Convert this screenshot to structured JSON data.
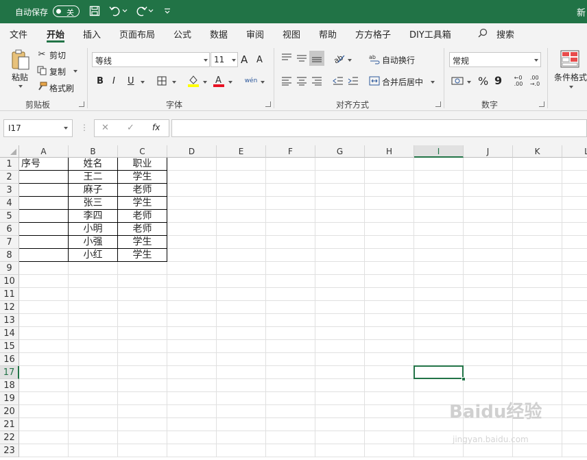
{
  "titlebar": {
    "autosave_label": "自动保存",
    "autosave_state": "关",
    "title": "新"
  },
  "tabs": [
    {
      "label": "文件"
    },
    {
      "label": "开始",
      "active": true
    },
    {
      "label": "插入"
    },
    {
      "label": "页面布局"
    },
    {
      "label": "公式"
    },
    {
      "label": "数据"
    },
    {
      "label": "审阅"
    },
    {
      "label": "视图"
    },
    {
      "label": "帮助"
    },
    {
      "label": "方方格子"
    },
    {
      "label": "DIY工具箱"
    }
  ],
  "search_label": "搜索",
  "ribbon": {
    "clipboard": {
      "paste": "粘贴",
      "cut": "剪切",
      "copy": "复制",
      "format_painter": "格式刷",
      "group_label": "剪贴板"
    },
    "font": {
      "font_name": "等线",
      "font_size": "11",
      "bold": "B",
      "italic": "I",
      "underline": "U",
      "grow": "A",
      "shrink": "A",
      "group_label": "字体"
    },
    "alignment": {
      "wrap_text": "自动换行",
      "merge_center": "合并后居中",
      "group_label": "对齐方式"
    },
    "number": {
      "format": "常规",
      "percent": "%",
      "comma": "9",
      "group_label": "数字"
    },
    "styles": {
      "conditional_format": "条件格式"
    }
  },
  "formula_bar": {
    "name_box": "I17",
    "cancel": "✕",
    "enter": "✓",
    "fx": "fx",
    "formula": ""
  },
  "columns": [
    "A",
    "B",
    "C",
    "D",
    "E",
    "F",
    "G",
    "H",
    "I",
    "J",
    "K",
    "L"
  ],
  "rows": [
    "1",
    "2",
    "3",
    "4",
    "5",
    "6",
    "7",
    "8",
    "9",
    "10",
    "11",
    "12",
    "13",
    "14",
    "15",
    "16",
    "17",
    "18",
    "19",
    "20",
    "21",
    "22",
    "23"
  ],
  "selected_cell": "I17",
  "table": {
    "headers": [
      "序号",
      "姓名",
      "职业"
    ],
    "data": [
      [
        "",
        "王二",
        "学生"
      ],
      [
        "",
        "麻子",
        "老师"
      ],
      [
        "",
        "张三",
        "学生"
      ],
      [
        "",
        "李四",
        "老师"
      ],
      [
        "",
        "小明",
        "老师"
      ],
      [
        "",
        "小强",
        "学生"
      ],
      [
        "",
        "小红",
        "学生"
      ]
    ]
  },
  "watermark": {
    "logo": "Baidu经验",
    "url": "jingyan.baidu.com"
  }
}
